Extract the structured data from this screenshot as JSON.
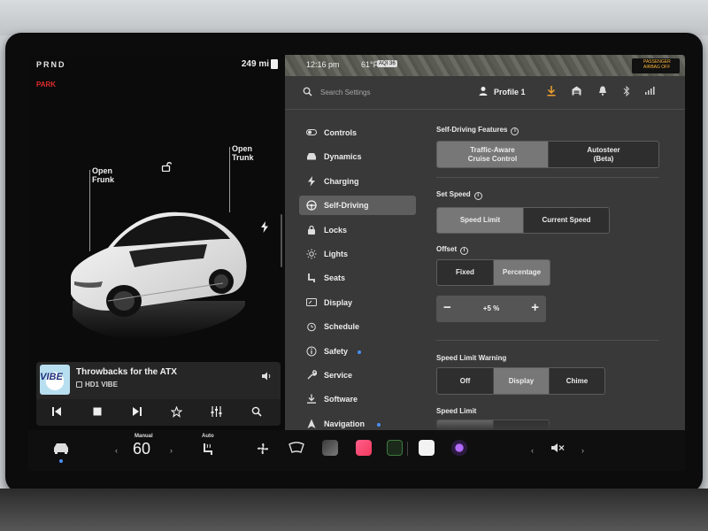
{
  "status": {
    "gear": "PRND",
    "park": "PARK",
    "range": "249 mi",
    "time": "12:16 pm",
    "temperature": "61°F",
    "aqi": "AQI 36",
    "airbag_line1": "PASSENGER",
    "airbag_line2": "AIRBAG OFF"
  },
  "car": {
    "frunk_label": "Open\nFrunk",
    "trunk_label": "Open\nTrunk"
  },
  "media": {
    "art_text": "VIBE",
    "title": "Throwbacks for the ATX",
    "station": "HD1 VIBE"
  },
  "settings": {
    "search_placeholder": "Search Settings",
    "profile": "Profile 1",
    "nav": [
      {
        "label": "Controls",
        "icon": "toggle-icon"
      },
      {
        "label": "Dynamics",
        "icon": "car-icon"
      },
      {
        "label": "Charging",
        "icon": "bolt-icon"
      },
      {
        "label": "Self-Driving",
        "icon": "steering-wheel-icon",
        "active": true
      },
      {
        "label": "Locks",
        "icon": "lock-icon"
      },
      {
        "label": "Lights",
        "icon": "sun-icon"
      },
      {
        "label": "Seats",
        "icon": "seat-icon"
      },
      {
        "label": "Display",
        "icon": "display-icon"
      },
      {
        "label": "Schedule",
        "icon": "alarm-icon"
      },
      {
        "label": "Safety",
        "icon": "info-icon",
        "dot": true
      },
      {
        "label": "Service",
        "icon": "wrench-icon"
      },
      {
        "label": "Software",
        "icon": "download-icon"
      },
      {
        "label": "Navigation",
        "icon": "navigation-icon",
        "dot": true
      }
    ],
    "self_driving_features": {
      "title": "Self-Driving Features",
      "options": [
        "Traffic-Aware\nCruise Control",
        "Autosteer\n(Beta)"
      ],
      "selected": 0
    },
    "set_speed": {
      "title": "Set Speed",
      "options": [
        "Speed Limit",
        "Current Speed"
      ],
      "selected": 0
    },
    "offset": {
      "title": "Offset",
      "options": [
        "Fixed",
        "Percentage"
      ],
      "selected": 1,
      "minus": "−",
      "value": "+5 %",
      "plus": "+"
    },
    "speed_limit_warning": {
      "title": "Speed Limit Warning",
      "options": [
        "Off",
        "Display",
        "Chime"
      ],
      "selected": 1
    },
    "speed_limit": {
      "title": "Speed Limit"
    }
  },
  "dock": {
    "climate_mode": "Manual",
    "temperature": "60",
    "seat_mode": "Auto"
  },
  "colors": {
    "accent_blue": "#4a8ff7",
    "park_red": "#e02b2b",
    "airbag_amber": "#ffb73a"
  }
}
